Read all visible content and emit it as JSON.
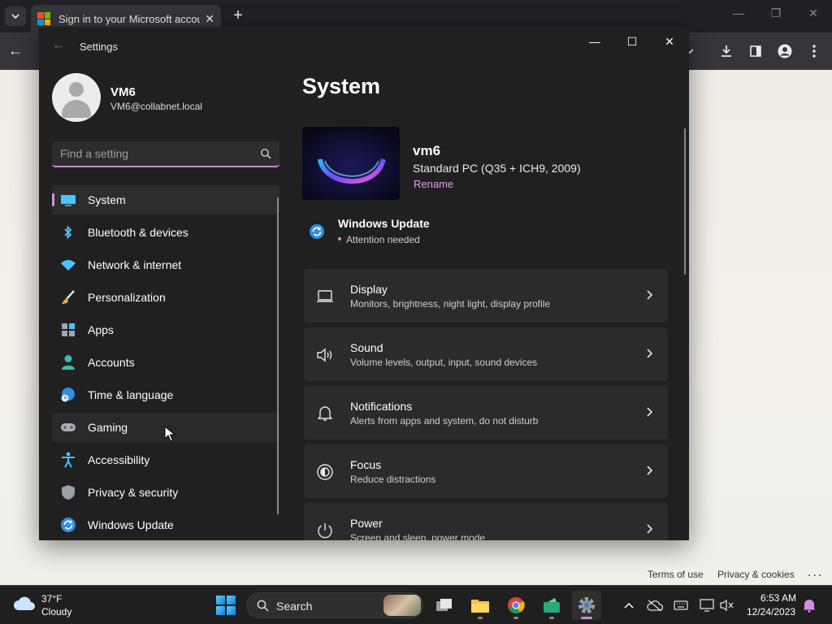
{
  "browser": {
    "tab_title": "Sign in to your Microsoft account",
    "tab_close": "✕",
    "new_tab": "+",
    "back": "←",
    "window_controls": {
      "minimize": "—",
      "restore": "❐",
      "close": "✕"
    }
  },
  "web_page": {
    "terms_label": "Terms of use",
    "privacy_label": "Privacy & cookies",
    "more_label": "..."
  },
  "settings": {
    "window_title": "Settings",
    "back": "←",
    "controls": {
      "minimize": "—",
      "maximize": "☐",
      "close": "✕"
    },
    "user": {
      "name": "VM6",
      "email": "VM6@collabnet.local"
    },
    "search_placeholder": "Find a setting",
    "accent_color": "#d38fe6",
    "nav": [
      {
        "label": "System",
        "icon": "monitor-icon",
        "selected": true
      },
      {
        "label": "Bluetooth & devices",
        "icon": "bluetooth-icon"
      },
      {
        "label": "Network & internet",
        "icon": "wifi-icon"
      },
      {
        "label": "Personalization",
        "icon": "brush-icon"
      },
      {
        "label": "Apps",
        "icon": "apps-icon"
      },
      {
        "label": "Accounts",
        "icon": "person-icon"
      },
      {
        "label": "Time & language",
        "icon": "globe-clock-icon"
      },
      {
        "label": "Gaming",
        "icon": "gamepad-icon",
        "hovered": true
      },
      {
        "label": "Accessibility",
        "icon": "accessibility-icon"
      },
      {
        "label": "Privacy & security",
        "icon": "shield-icon"
      },
      {
        "label": "Windows Update",
        "icon": "sync-icon"
      }
    ],
    "page_title": "System",
    "device": {
      "name": "vm6",
      "model": "Standard PC (Q35 + ICH9, 2009)",
      "rename_label": "Rename"
    },
    "windows_update": {
      "title": "Windows Update",
      "status": "Attention needed"
    },
    "cards": [
      {
        "title": "Display",
        "desc": "Monitors, brightness, night light, display profile",
        "icon": "laptop-icon"
      },
      {
        "title": "Sound",
        "desc": "Volume levels, output, input, sound devices",
        "icon": "speaker-icon"
      },
      {
        "title": "Notifications",
        "desc": "Alerts from apps and system, do not disturb",
        "icon": "bell-icon"
      },
      {
        "title": "Focus",
        "desc": "Reduce distractions",
        "icon": "focus-icon"
      },
      {
        "title": "Power",
        "desc": "Screen and sleep, power mode",
        "icon": "power-icon"
      }
    ]
  },
  "taskbar": {
    "weather": {
      "temp": "37°F",
      "condition": "Cloudy"
    },
    "search_label": "Search",
    "clock": {
      "time": "6:53 AM",
      "date": "12/24/2023"
    }
  }
}
